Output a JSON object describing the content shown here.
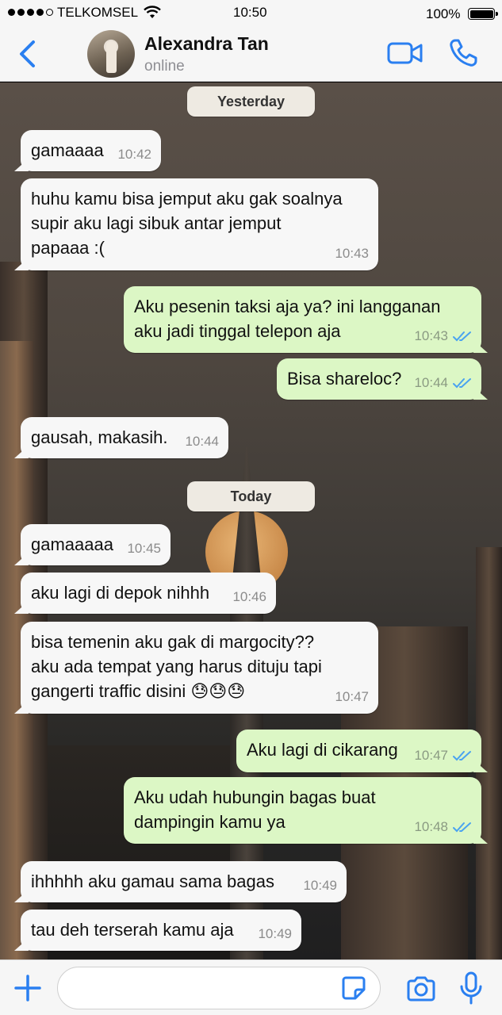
{
  "status_bar": {
    "carrier": "TELKOMSEL",
    "time": "10:50",
    "battery": "100%"
  },
  "header": {
    "name": "Alexandra Tan",
    "status": "online"
  },
  "colors": {
    "accent": "#2a7ff0",
    "outgoing_bubble": "#dcf7c5",
    "incoming_bubble": "#f7f7f7"
  },
  "days": {
    "yesterday": "Yesterday",
    "today": "Today"
  },
  "messages": [
    {
      "dir": "in",
      "lines": [
        "gamaaaa"
      ],
      "time": "10:42"
    },
    {
      "dir": "in",
      "lines": [
        "huhu kamu bisa jemput aku gak soalnya",
        "supir aku lagi sibuk antar jemput",
        "papaaa :("
      ],
      "time": "10:43"
    },
    {
      "dir": "out",
      "lines": [
        "Aku pesenin taksi aja ya? ini langganan",
        "aku jadi tinggal telepon aja"
      ],
      "time": "10:43"
    },
    {
      "dir": "out",
      "lines": [
        "Bisa shareloc?"
      ],
      "time": "10:44"
    },
    {
      "dir": "in",
      "lines": [
        "gausah, makasih."
      ],
      "time": "10:44"
    },
    {
      "dir": "in",
      "lines": [
        "gamaaaaa"
      ],
      "time": "10:45"
    },
    {
      "dir": "in",
      "lines": [
        "aku lagi di depok nihhh"
      ],
      "time": "10:46"
    },
    {
      "dir": "in",
      "lines": [
        "bisa temenin aku gak di margocity??",
        "aku ada tempat yang harus dituju tapi",
        "gangerti traffic disini 😓😓😓"
      ],
      "time": "10:47"
    },
    {
      "dir": "out",
      "lines": [
        "Aku lagi di cikarang"
      ],
      "time": "10:47"
    },
    {
      "dir": "out",
      "lines": [
        "Aku udah hubungin bagas buat",
        "dampingin kamu ya"
      ],
      "time": "10:48"
    },
    {
      "dir": "in",
      "lines": [
        "ihhhhh aku gamau sama bagas"
      ],
      "time": "10:49"
    },
    {
      "dir": "in",
      "lines": [
        "tau deh terserah kamu aja"
      ],
      "time": "10:49"
    }
  ],
  "input": {
    "placeholder": ""
  },
  "icons": [
    "back-chevron-icon",
    "video-call-icon",
    "phone-icon",
    "plus-icon",
    "sticker-icon",
    "camera-icon",
    "microphone-icon",
    "read-receipt-icon"
  ]
}
